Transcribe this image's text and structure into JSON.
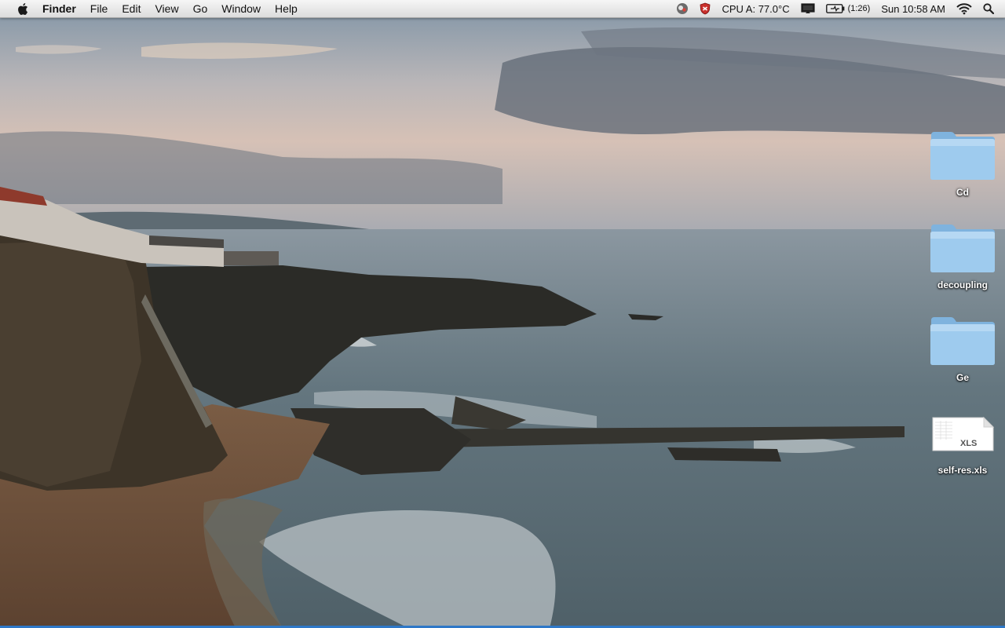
{
  "menubar": {
    "apple_icon": "apple-logo",
    "app_name": "Finder",
    "items": [
      "File",
      "Edit",
      "View",
      "Go",
      "Window",
      "Help"
    ],
    "status": {
      "cpu": "CPU A: 77.0°C",
      "battery_time": "(1:26)",
      "clock": "Sun 10:58 AM",
      "icons": [
        "gpu-activity-icon",
        "security-shield-icon",
        "display-icon",
        "battery-icon",
        "wifi-icon",
        "spotlight-search-icon"
      ]
    }
  },
  "desktop": {
    "icons": [
      {
        "label": "Cd",
        "kind": "folder"
      },
      {
        "label": "decoupling",
        "kind": "folder"
      },
      {
        "label": "Ge",
        "kind": "folder"
      },
      {
        "label": "self-res.xls",
        "kind": "document",
        "badge": "XLS"
      }
    ]
  },
  "colors": {
    "folder": "#8fc3ea",
    "selection_line": "#2e78c8"
  }
}
